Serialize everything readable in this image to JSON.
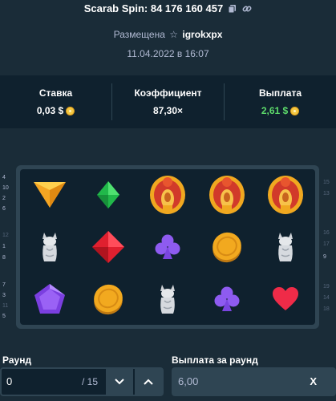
{
  "header": {
    "title": "Scarab Spin: 84 176 160 457",
    "placed_prefix": "Размещена",
    "username": "igrokxpx",
    "date": "11.04.2022 в 16:07"
  },
  "stats": {
    "bet_label": "Ставка",
    "bet_value": "0,03 $",
    "multiplier_label": "Коэффициент",
    "multiplier_value": "87,30×",
    "payout_label": "Выплата",
    "payout_value": "2,61 $"
  },
  "lines_left": [
    "4",
    "10",
    "2",
    "6",
    "12",
    "1",
    "8",
    "7",
    "3",
    "11",
    "5"
  ],
  "lines_right": [
    "15",
    "13",
    "16",
    "17",
    "9",
    "19",
    "14",
    "18"
  ],
  "reels": [
    [
      "triangle-gem-icon",
      "cat-statue-icon",
      "pentagon-gem-icon"
    ],
    [
      "diamond-green-icon",
      "diamond-red-icon",
      "gold-coin-icon"
    ],
    [
      "scarab-icon",
      "club-icon",
      "cat-statue-icon"
    ],
    [
      "scarab-icon",
      "gold-coin-icon",
      "club-icon"
    ],
    [
      "scarab-icon",
      "cat-statue-icon",
      "heart-icon"
    ]
  ],
  "round": {
    "label": "Раунд",
    "value": "0",
    "total": "/ 15"
  },
  "round_payout": {
    "label": "Выплата за раунд",
    "value": "6,00",
    "suffix": "X"
  },
  "colors": {
    "background": "#1a2c38",
    "panel": "#0f212e",
    "accent": "#2f4553",
    "win_green": "#5ddb6b",
    "coin_gold": "#f5c842"
  }
}
